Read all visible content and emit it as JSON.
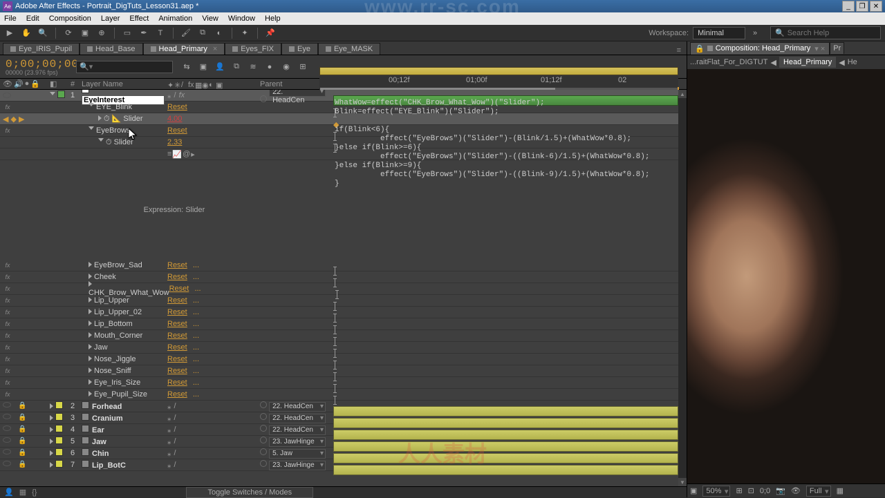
{
  "titlebar": {
    "app": "Adobe After Effects",
    "project": "Portrait_DigTuts_Lesson31.aep *"
  },
  "menu": [
    "File",
    "Edit",
    "Composition",
    "Layer",
    "Effect",
    "Animation",
    "View",
    "Window",
    "Help"
  ],
  "workspace": {
    "label": "Workspace:",
    "value": "Minimal"
  },
  "search_help": {
    "placeholder": "Search Help"
  },
  "comp_tabs": [
    {
      "name": "Eye_IRIS_Pupil",
      "active": false
    },
    {
      "name": "Head_Base",
      "active": false
    },
    {
      "name": "Head_Primary",
      "active": true
    },
    {
      "name": "Eyes_FIX",
      "active": false
    },
    {
      "name": "Eye",
      "active": false
    },
    {
      "name": "Eye_MASK",
      "active": false
    }
  ],
  "timecode": {
    "value": "0;00;00;00",
    "sub": "00000 (23.976 fps)"
  },
  "ruler": {
    "t1": "00;12f",
    "t2": "01;00f",
    "t3": "01;12f",
    "t4": "02"
  },
  "headers": {
    "num": "#",
    "layer": "Layer Name",
    "parent": "Parent"
  },
  "layer1": {
    "num": "1",
    "name": "EyeInterest",
    "parent": "22. HeadCen",
    "effects": [
      {
        "name": "EYE_Blink",
        "reset": "Reset",
        "slider_label": "Slider",
        "slider_val": "4.00"
      },
      {
        "name": "EyeBrows",
        "reset": "Reset",
        "slider_label": "Slider",
        "slider_val": "2.33"
      }
    ],
    "expr_label": "Expression: Slider",
    "expr_code": "WhatWow=effect(\"CHK_Brow_What_Wow\")(\"Slider\");\nBlink=effect(\"EYE_Blink\")(\"Slider\");\n\nif(Blink<6){\n          effect(\"EyeBrows\")(\"Slider\")-(Blink/1.5)+(WhatWow*0.8);\n}else if(Blink>=6){\n          effect(\"EyeBrows\")(\"Slider\")-((Blink-6)/1.5)+(WhatWow*0.8);\n}else if(Blink>=9){\n          effect(\"EyeBrows\")(\"Slider\")-((Blink-9)/1.5)+(WhatWow*0.8);\n}",
    "more_effects": [
      {
        "name": "EyeBrow_Sad",
        "reset": "Reset"
      },
      {
        "name": "Cheek",
        "reset": "Reset"
      },
      {
        "name": "CHK_Brow_What_Wow",
        "reset": "Reset"
      },
      {
        "name": "Lip_Upper",
        "reset": "Reset"
      },
      {
        "name": "Lip_Upper_02",
        "reset": "Reset"
      },
      {
        "name": "Lip_Bottom",
        "reset": "Reset"
      },
      {
        "name": "Mouth_Corner",
        "reset": "Reset"
      },
      {
        "name": "Jaw",
        "reset": "Reset"
      },
      {
        "name": "Nose_Jiggle",
        "reset": "Reset"
      },
      {
        "name": "Nose_Sniff",
        "reset": "Reset"
      },
      {
        "name": "Eye_Iris_Size",
        "reset": "Reset"
      },
      {
        "name": "Eye_Pupil_Size",
        "reset": "Reset"
      }
    ]
  },
  "layers_rest": [
    {
      "num": "2",
      "name": "Forhead",
      "color": "#d8d848",
      "parent": "22. HeadCen"
    },
    {
      "num": "3",
      "name": "Cranium",
      "color": "#d8d848",
      "parent": "22. HeadCen"
    },
    {
      "num": "4",
      "name": "Ear",
      "color": "#d8d848",
      "parent": "22. HeadCen"
    },
    {
      "num": "5",
      "name": "Jaw",
      "color": "#d8d848",
      "parent": "23. JawHinge"
    },
    {
      "num": "6",
      "name": "Chin",
      "color": "#d8d848",
      "parent": "5. Jaw"
    },
    {
      "num": "7",
      "name": "Lip_BotC",
      "color": "#d8d848",
      "parent": "23. JawHinge"
    }
  ],
  "footer": {
    "toggle": "Toggle Switches / Modes"
  },
  "viewer": {
    "tab_label": "Composition: Head_Primary",
    "tab2": "Pr",
    "bc1": "...raitFlat_For_DIGTUT",
    "bc2": "Head_Primary",
    "bc3": "He",
    "zoom": "50%",
    "res": "Full"
  },
  "watermark": {
    "top": "www.rr-sc.com",
    "bottom": "人人素材"
  }
}
